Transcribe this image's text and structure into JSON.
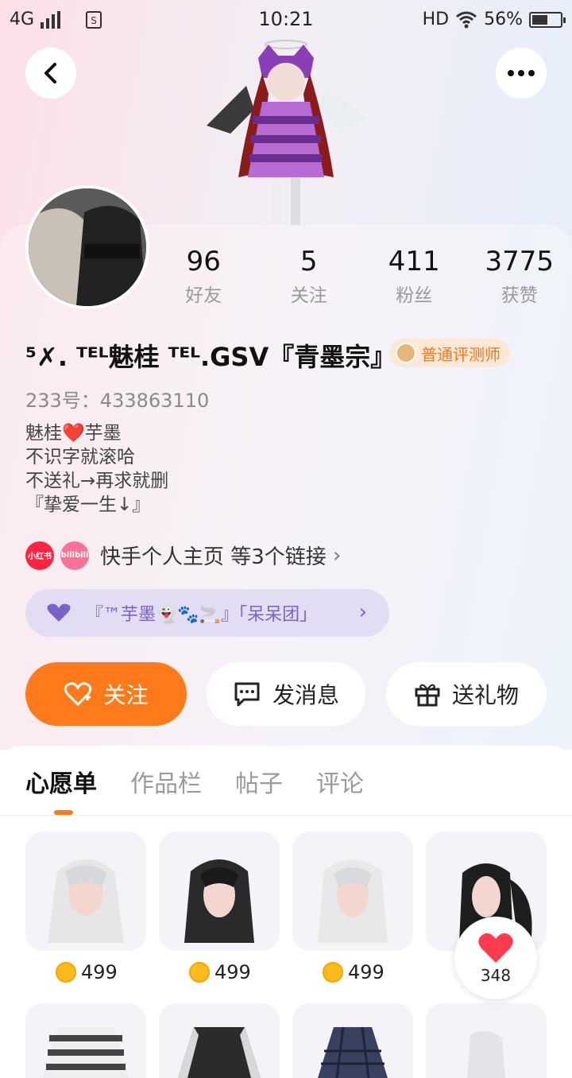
{
  "status_bar": {
    "network": "4G",
    "time": "10:21",
    "hd": "HD",
    "battery": "56%",
    "battery_level": 0.56
  },
  "header": {
    "back_icon": "chevron-left-icon",
    "more_icon": "more-horizontal-icon"
  },
  "profile": {
    "stats": [
      {
        "value": "96",
        "label": "好友"
      },
      {
        "value": "5",
        "label": "关注"
      },
      {
        "value": "411",
        "label": "粉丝"
      },
      {
        "value": "3775",
        "label": "获赞"
      }
    ],
    "name": "⁵✗. ᵀᴱᴸ魅桂 ᵀᴱᴸ.GSV『青墨宗』",
    "badge": "普通评测师",
    "uid": "233号：433863110",
    "bio": [
      "魅桂❤️芋墨",
      "不识字就滚哈",
      "不送礼→再求就删",
      "『挚爱一生↓』"
    ],
    "links": {
      "icon1": "小红书",
      "icon2": "bilibili",
      "text": "快手个人主页 等3个链接",
      "chevron": "›"
    },
    "group": {
      "text": "『™芋墨👻🐾🚬』「呆呆团」",
      "chevron": "›"
    }
  },
  "actions": {
    "follow": "关注",
    "message": "发消息",
    "gift": "送礼物"
  },
  "tabs": [
    "心愿单",
    "作品栏",
    "帖子",
    "评论"
  ],
  "active_tab": 0,
  "wishlist": [
    {
      "price": "499"
    },
    {
      "price": "499"
    },
    {
      "price": "499"
    }
  ],
  "like_float": {
    "count": "348"
  },
  "colors": {
    "accent": "#ff7a1a",
    "group_text": "#7b62c9",
    "badge_text": "#f0781e"
  }
}
